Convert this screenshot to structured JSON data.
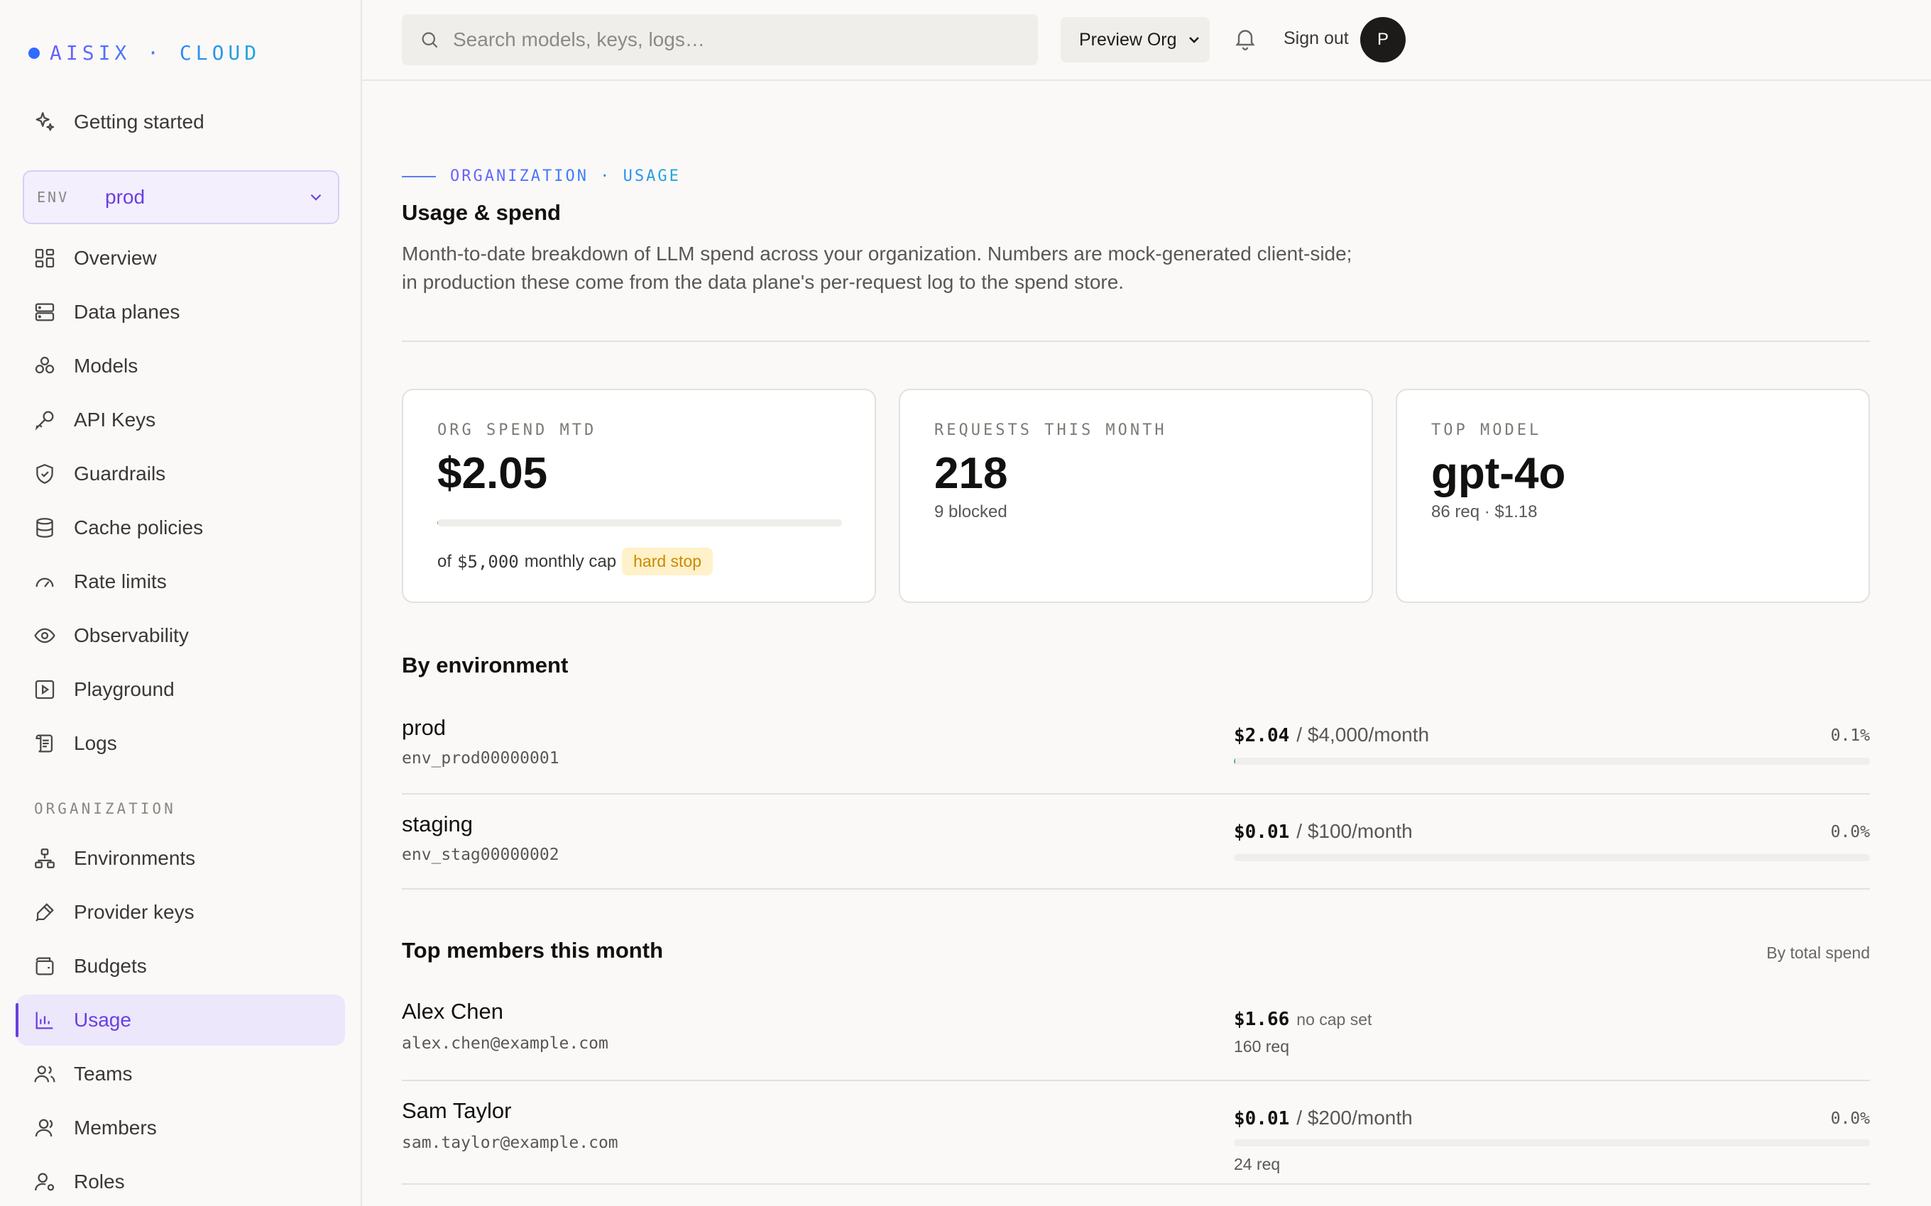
{
  "brand": {
    "logo_text": "AISIX · CLOUD"
  },
  "sidebar": {
    "getting_started": "Getting started",
    "env": {
      "label": "ENV",
      "value": "prod"
    },
    "items": [
      {
        "label": "Overview",
        "icon": "grid-icon"
      },
      {
        "label": "Data planes",
        "icon": "server-icon"
      },
      {
        "label": "Models",
        "icon": "cubes-icon"
      },
      {
        "label": "API Keys",
        "icon": "key-icon"
      },
      {
        "label": "Guardrails",
        "icon": "shield-icon"
      },
      {
        "label": "Cache policies",
        "icon": "database-icon"
      },
      {
        "label": "Rate limits",
        "icon": "gauge-icon"
      },
      {
        "label": "Observability",
        "icon": "eye-icon"
      },
      {
        "label": "Playground",
        "icon": "play-square-icon"
      },
      {
        "label": "Logs",
        "icon": "scroll-icon"
      }
    ],
    "org_section_label": "ORGANIZATION",
    "org_items": [
      {
        "label": "Environments",
        "icon": "hierarchy-icon"
      },
      {
        "label": "Provider keys",
        "icon": "pen-icon"
      },
      {
        "label": "Budgets",
        "icon": "wallet-icon"
      },
      {
        "label": "Usage",
        "icon": "bar-chart-icon",
        "active": true
      },
      {
        "label": "Teams",
        "icon": "users-icon"
      },
      {
        "label": "Members",
        "icon": "user-icon"
      },
      {
        "label": "Roles",
        "icon": "user-cog-icon"
      }
    ]
  },
  "header": {
    "search_placeholder": "Search models, keys, logs…",
    "org": "Preview Org",
    "sign_out": "Sign out",
    "avatar_initial": "P"
  },
  "page": {
    "eyebrow": "ORGANIZATION · USAGE",
    "title": "Usage & spend",
    "description": "Month-to-date breakdown of LLM spend across your organization. Numbers are mock-generated client-side; in production these come from the data plane's per-request log to the spend store."
  },
  "stats": {
    "spend": {
      "label": "ORG SPEND MTD",
      "value": "$2.05",
      "progress": 0.0004,
      "cap_prefix": "of",
      "cap_amount": "$5,000",
      "cap_suffix": "monthly cap",
      "badge": "hard stop"
    },
    "requests": {
      "label": "REQUESTS THIS MONTH",
      "value": "218",
      "sub": "9 blocked"
    },
    "top_model": {
      "label": "TOP MODEL",
      "value": "gpt-4o",
      "sub": "86 req · $1.18"
    }
  },
  "by_environment": {
    "title": "By environment",
    "rows": [
      {
        "name": "prod",
        "id": "env_prod00000001",
        "spend": "$2.04",
        "budget": "/ $4,000/month",
        "pct": "0.1%",
        "progress": 0.001
      },
      {
        "name": "staging",
        "id": "env_stag00000002",
        "spend": "$0.01",
        "budget": "/ $100/month",
        "pct": "0.0%",
        "progress": 0.0
      }
    ]
  },
  "top_members": {
    "title": "Top members this month",
    "sort_label": "By total spend",
    "rows": [
      {
        "name": "Alex Chen",
        "email": "alex.chen@example.com",
        "spend": "$1.66",
        "note": "no cap set",
        "requests": "160 req"
      },
      {
        "name": "Sam Taylor",
        "email": "sam.taylor@example.com",
        "spend": "$0.01",
        "budget": "/ $200/month",
        "pct": "0.0%",
        "requests": "24 req",
        "progress": 0.0
      }
    ]
  },
  "colors": {
    "accent": "#6a3fe0",
    "brand_blue": "#2f6bff",
    "progress": "#3bb58a",
    "badge_bg": "#fff1c9",
    "badge_text": "#c98a00"
  }
}
